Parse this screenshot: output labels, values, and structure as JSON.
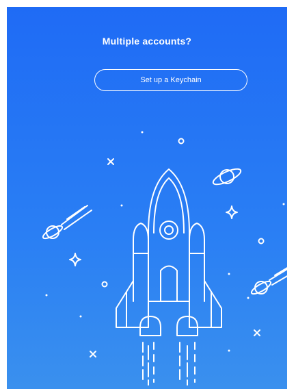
{
  "header": {
    "title": "Multiple accounts?"
  },
  "actions": {
    "setup_keychain_label": "Set up a Keychain"
  },
  "illustration": {
    "icon": "rocket-launch-illustration",
    "elements": [
      "rocket-icon",
      "planet-icon",
      "star-icon",
      "comet-icon"
    ]
  },
  "colors": {
    "background_top": "#1f6bf5",
    "background_bottom": "#3a90ee",
    "foreground": "#ffffff"
  }
}
